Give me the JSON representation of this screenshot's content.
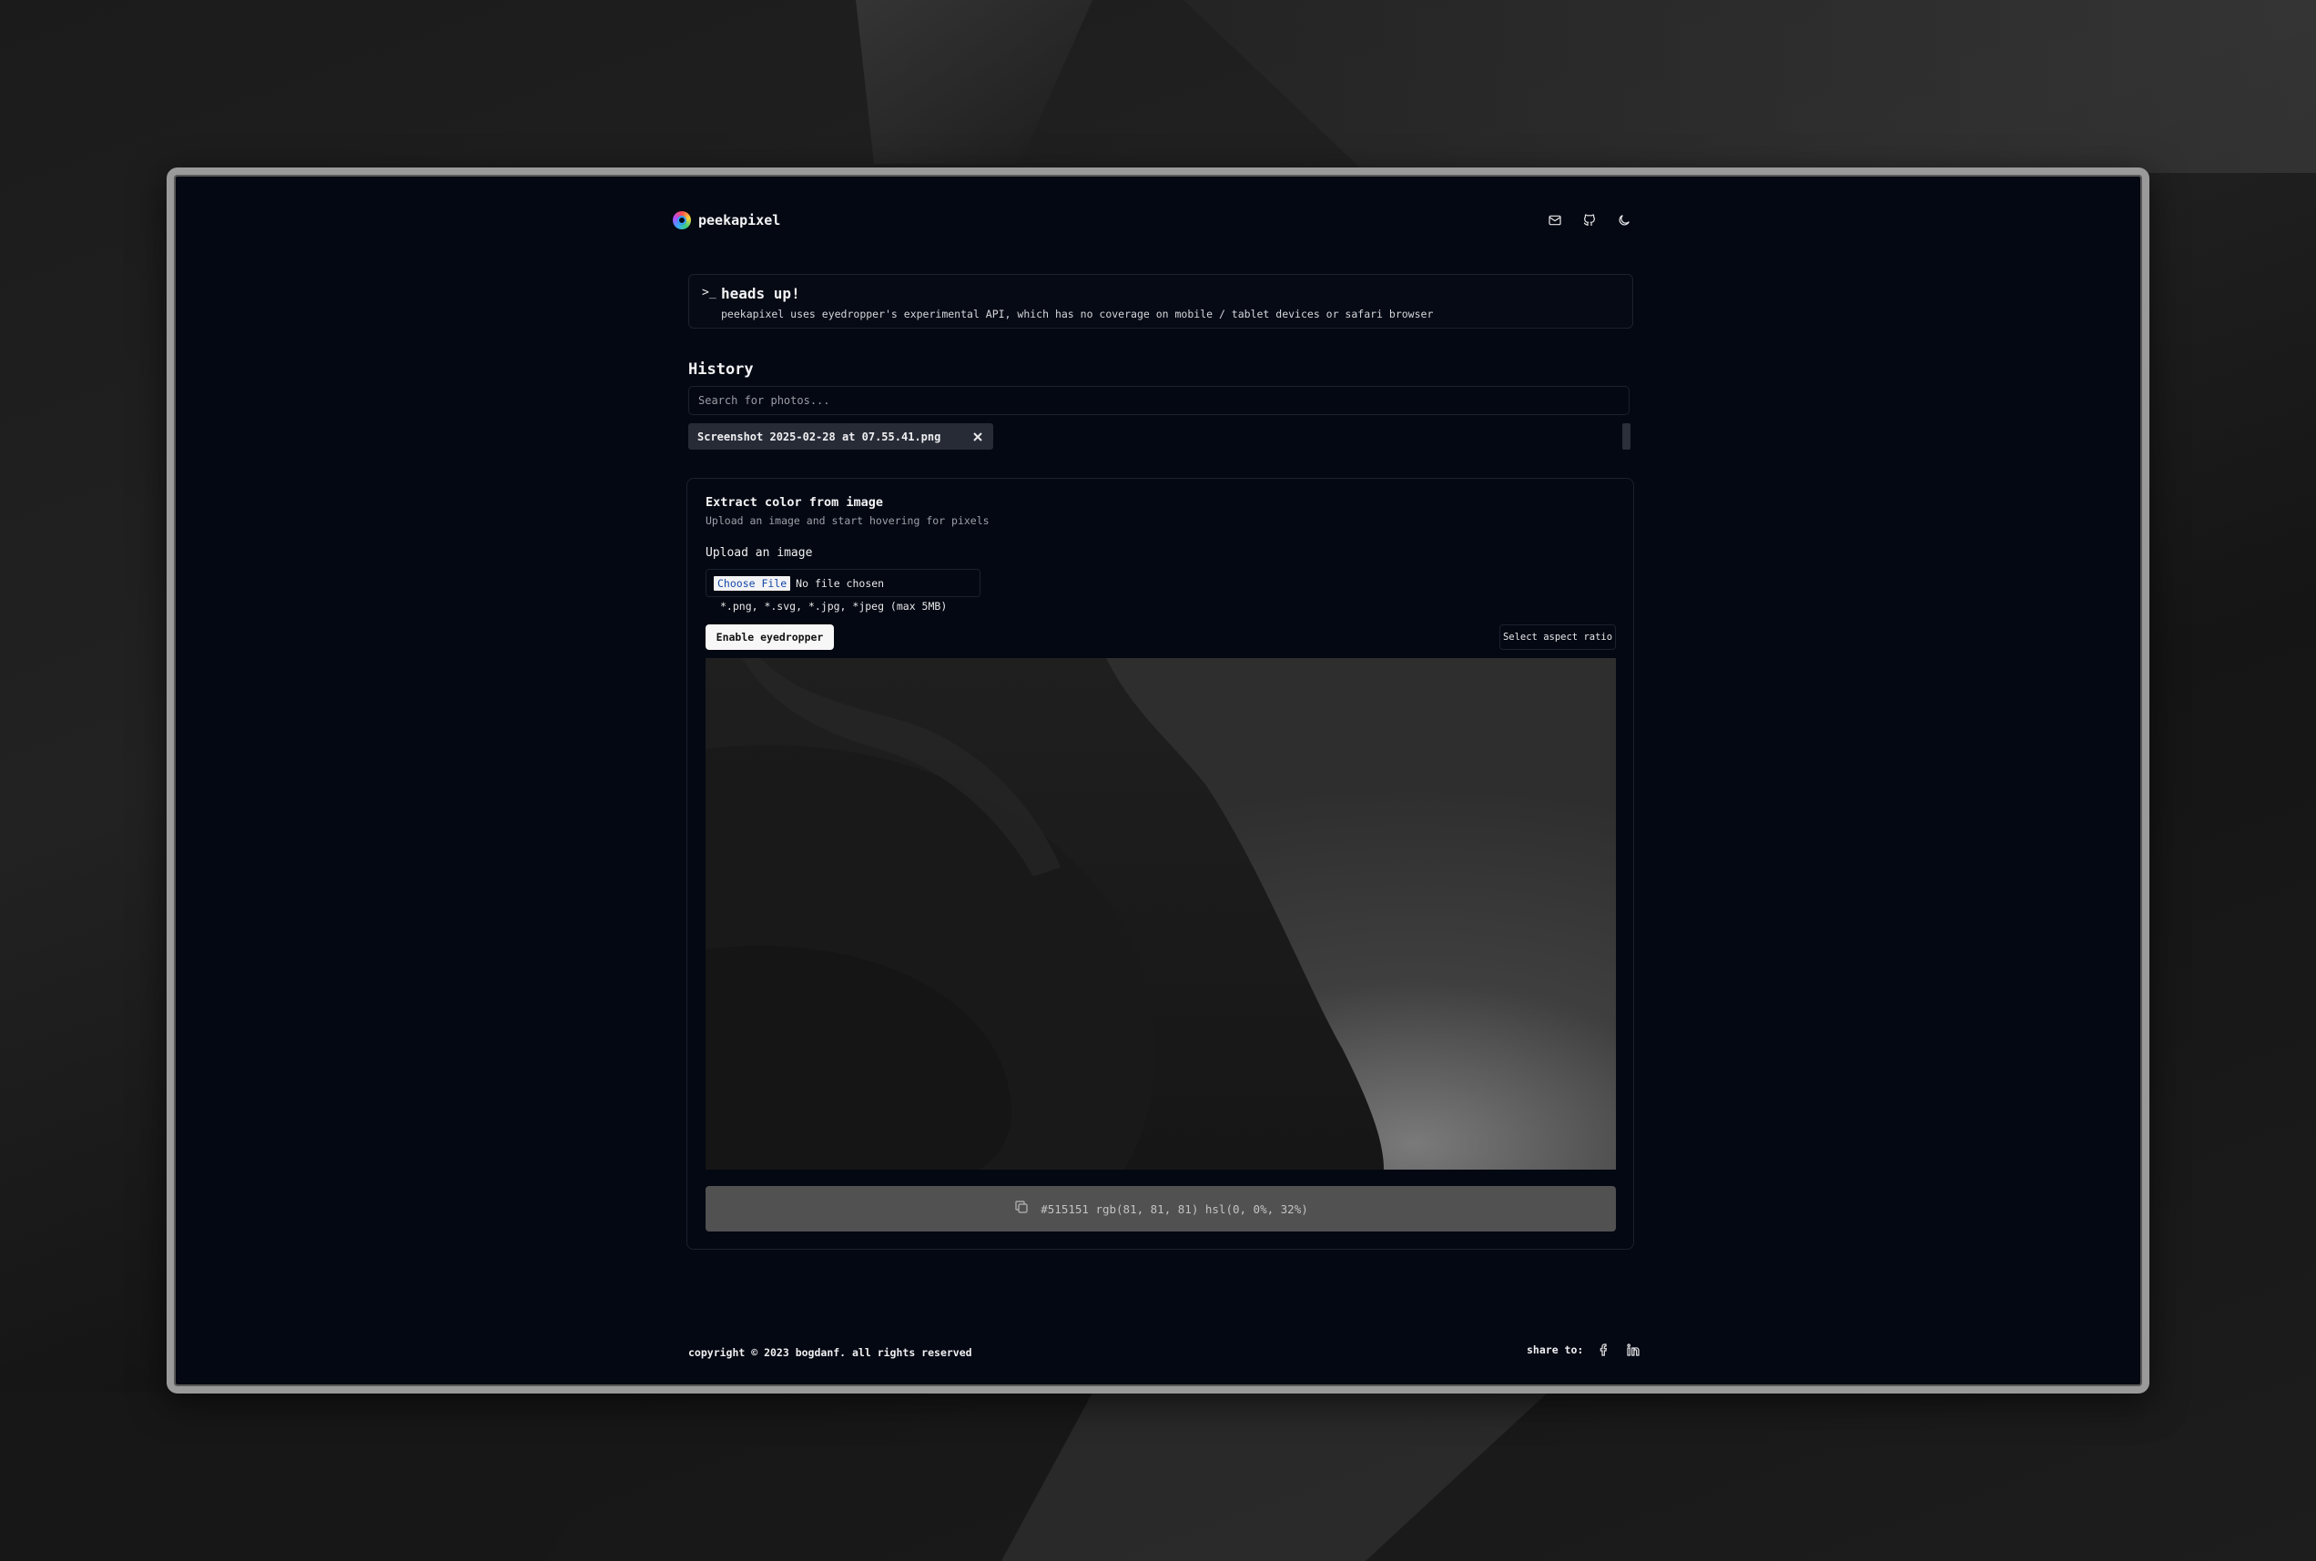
{
  "colors": {
    "app_bg": "#040812",
    "border": "#1c2130",
    "chip_bg": "#262b36",
    "picked_color": "#515151"
  },
  "header": {
    "brand": "peekapixel",
    "icons": [
      "mail-icon",
      "github-icon",
      "moon-icon"
    ]
  },
  "alert": {
    "icon": "terminal-icon",
    "title": "heads up!",
    "description": "peekapixel uses eyedropper's experimental API, which has no coverage on mobile / tablet devices or safari browser"
  },
  "history": {
    "title": "History",
    "search_placeholder": "Search for photos...",
    "items": [
      {
        "label": "Screenshot 2025-02-28 at 07.55.41.png"
      }
    ]
  },
  "extract": {
    "title": "Extract color from image",
    "subtitle": "Upload an image and start hovering for pixels",
    "upload_label": "Upload an image",
    "choose_file": "Choose File",
    "file_status": "No file chosen",
    "file_hint": "*.png, *.svg, *.jpg, *jpeg (max 5MB)",
    "eyedropper_button": "Enable eyedropper",
    "aspect_button": "Select aspect ratio",
    "color_readout": "#515151 rgb(81, 81, 81) hsl(0, 0%, 32%)"
  },
  "footer": {
    "copyright": "copyright © 2023 bogdanf. all rights reserved",
    "share_label": "share to:",
    "share_icons": [
      "facebook-icon",
      "linkedin-icon"
    ]
  }
}
